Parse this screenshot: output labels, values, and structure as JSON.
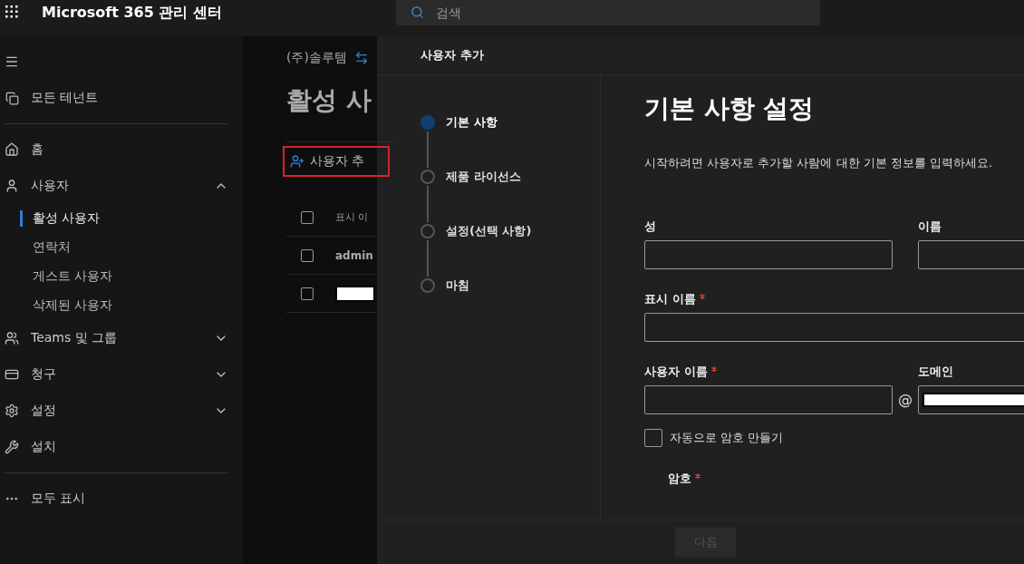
{
  "topbar": {
    "title": "Microsoft 365 관리 센터",
    "search": {
      "placeholder": "검색"
    }
  },
  "sidebar": {
    "top_items": [
      {
        "label": "모든 테넌트"
      }
    ],
    "nav_items": [
      {
        "label": "홈"
      },
      {
        "label": "사용자",
        "expanded": true,
        "children": [
          {
            "label": "활성 사용자",
            "selected": true
          },
          {
            "label": "연락처",
            "selected": false
          },
          {
            "label": "게스트 사용자",
            "selected": false
          },
          {
            "label": "삭제된 사용자",
            "selected": false
          }
        ]
      },
      {
        "label": "Teams 및 그룹",
        "expanded": false
      },
      {
        "label": "청구",
        "expanded": false
      },
      {
        "label": "설정",
        "expanded": false
      },
      {
        "label": "설치"
      }
    ],
    "more_item": {
      "label": "모두 표시"
    }
  },
  "main": {
    "breadcrumb": "(주)솔루템",
    "title": "활성 사",
    "add_user_button": "사용자 추",
    "table": {
      "header": {
        "checked": false,
        "column_1": "표시 이"
      },
      "rows": [
        {
          "checked": false,
          "name": "admin",
          "redacted": false
        },
        {
          "checked": false,
          "name": "",
          "redacted": true
        }
      ]
    }
  },
  "panel": {
    "title": "사용자 추가",
    "steps": [
      {
        "label": "기본 사항",
        "selected": true
      },
      {
        "label": "제품 라이선스",
        "selected": false
      },
      {
        "label": "설정(선택 사항)",
        "selected": false
      },
      {
        "label": "마침",
        "selected": false
      }
    ],
    "heading": "기본 사항 설정",
    "description": "시작하려면 사용자로 추가할 사람에 대한 기본 정보를 입력하세요.",
    "rows": [
      {
        "fields": [
          {
            "label": "성",
            "required": false
          },
          {
            "label": "이름",
            "required": false
          }
        ]
      },
      {
        "fields": [
          {
            "label": "표시 이름",
            "required": true
          }
        ]
      },
      {
        "fields": [
          {
            "label": "사용자 이름",
            "required": true
          },
          {
            "label": "도메인",
            "required": false,
            "prefix": "@",
            "redacted": true
          }
        ]
      }
    ],
    "auto_password": {
      "label": "자동으로 암호 만들기",
      "checked": false
    },
    "password": {
      "label": "암호",
      "required": true
    },
    "next_button": {
      "label": "다음",
      "disabled": true
    }
  }
}
